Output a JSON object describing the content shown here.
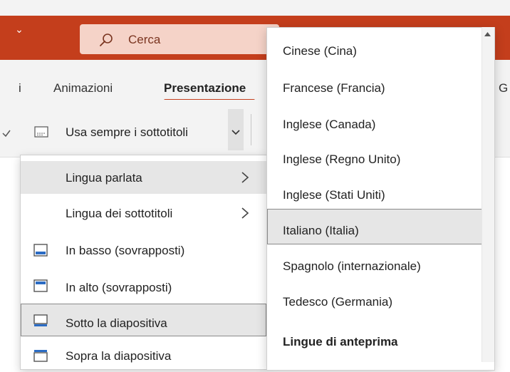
{
  "search": {
    "label": "Cerca"
  },
  "ribbon": {
    "tabs": [
      {
        "label": "i"
      },
      {
        "label": "Animazioni"
      },
      {
        "label": "Presentazione"
      },
      {
        "label": "G"
      }
    ],
    "captions_button_label": "Usa sempre i sottotitoli",
    "accent_color": "#c43e1c"
  },
  "subtitles_menu": {
    "items": [
      {
        "label": "Lingua parlata",
        "has_submenu": true,
        "icon": ""
      },
      {
        "label": "Lingua dei sottotitoli",
        "has_submenu": true,
        "icon": ""
      },
      {
        "label": "In basso (sovrapposti)",
        "icon": "position-bottom-overlay-icon"
      },
      {
        "label": "In alto (sovrapposti)",
        "icon": "position-top-overlay-icon"
      },
      {
        "label": "Sotto la diapositiva",
        "icon": "position-below-slide-icon"
      },
      {
        "label": "Sopra la diapositiva",
        "icon": "position-above-slide-icon"
      }
    ]
  },
  "spoken_language_menu": {
    "items": [
      {
        "label": "Cinese (Cina)"
      },
      {
        "label": "Francese (Francia)"
      },
      {
        "label": "Inglese (Canada)"
      },
      {
        "label": "Inglese (Regno Unito)"
      },
      {
        "label": "Inglese (Stati Uniti)"
      },
      {
        "label": "Italiano (Italia)"
      },
      {
        "label": "Spagnolo (internazionale)"
      },
      {
        "label": "Tedesco (Germania)"
      }
    ],
    "preview_header": "Lingue di anteprima"
  }
}
